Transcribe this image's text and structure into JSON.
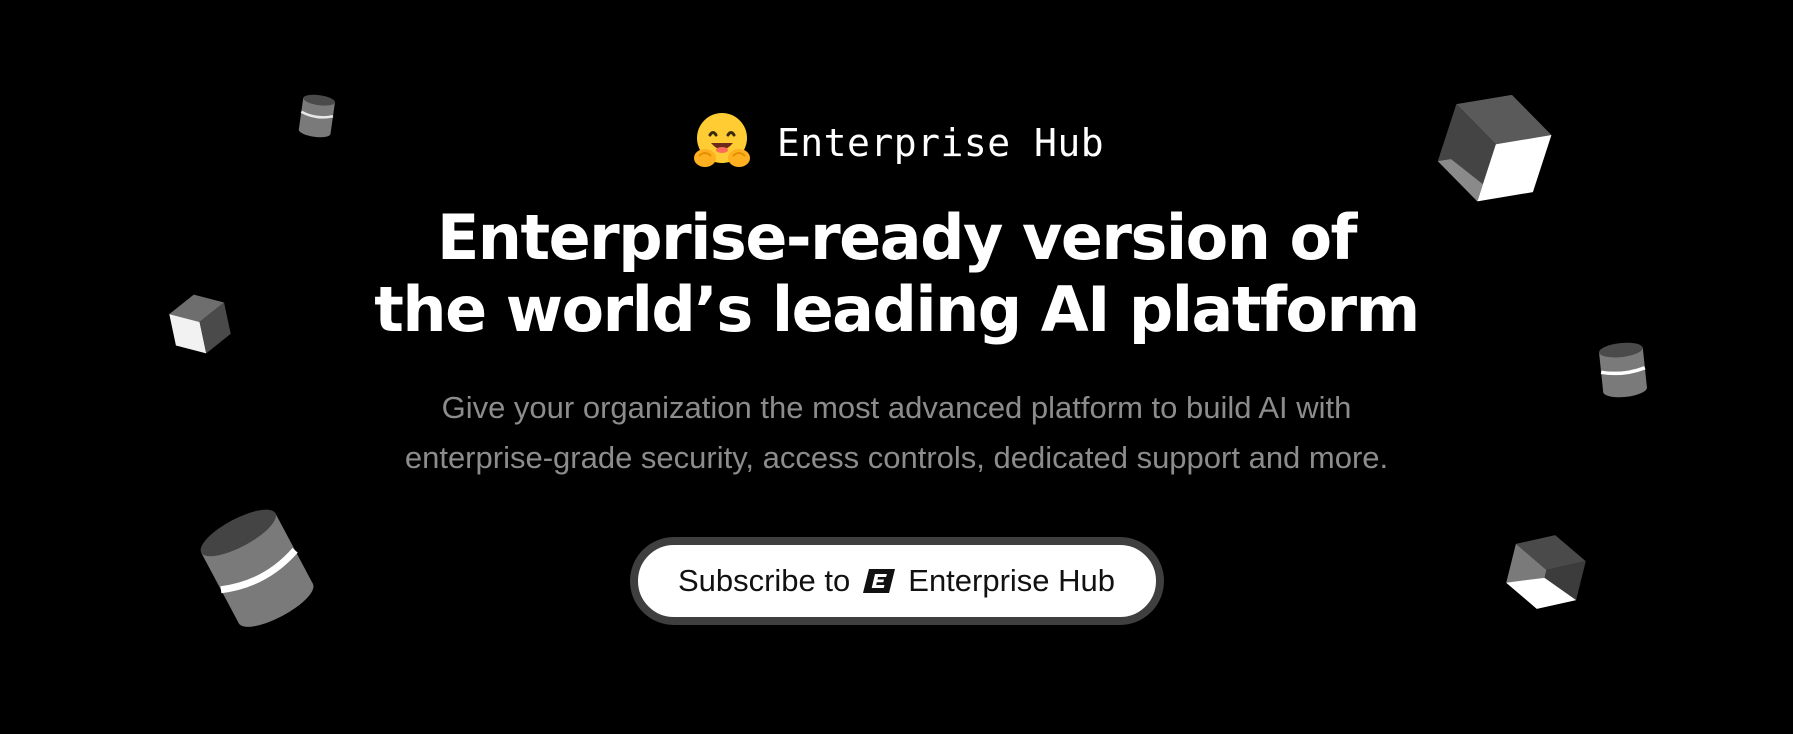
{
  "brand": {
    "emoji_icon": "hugging-face-emoji-icon",
    "name": "Enterprise Hub"
  },
  "headline": {
    "line1": "Enterprise-ready version of",
    "line2": "the world’s leading AI platform"
  },
  "subtext": {
    "line1": "Give your organization the most advanced platform to build AI with",
    "line2": "enterprise-grade security, access controls, dedicated support and more."
  },
  "cta": {
    "prefix": "Subscribe to",
    "icon": "enterprise-e-badge-icon",
    "suffix": "Enterprise Hub"
  },
  "colors": {
    "background": "#000000",
    "headline": "#ffffff",
    "subtext": "#8c8c8c",
    "button_fill": "#ffffff",
    "button_border": "#3f3f3f",
    "emoji": "#ffcc33"
  }
}
